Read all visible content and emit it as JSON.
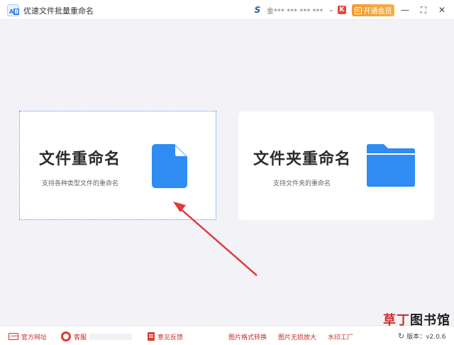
{
  "window": {
    "title": "优速文件批量重命名",
    "user_name": "金*** *** *** ***",
    "vip_button_label": "开通会员",
    "vip_mark": "K",
    "minimize": "—",
    "maximize": "⛶",
    "close": "✕"
  },
  "cards": [
    {
      "title": "文件重命名",
      "subtitle": "支持各种类型文件的重命名",
      "icon": "file-icon",
      "selected": true
    },
    {
      "title": "文件夹重命名",
      "subtitle": "支持文件夹的重命名",
      "icon": "folder-icon",
      "selected": false
    }
  ],
  "footer": {
    "website_label": "官方网址",
    "website_icon_text": ".com",
    "service_label": "客服",
    "feedback_label": "意见反馈",
    "links": [
      "图片格式转换",
      "图片无损放大",
      "水印工厂"
    ],
    "version_label": "版本：v2.0.6"
  },
  "watermark": {
    "part1": "草丁",
    "part2": "图书馆"
  },
  "colors": {
    "accent_blue": "#2f8cf2",
    "vip_orange": "#f79a2e",
    "arrow_red": "#e03a3a",
    "link_red": "#c62f24"
  }
}
